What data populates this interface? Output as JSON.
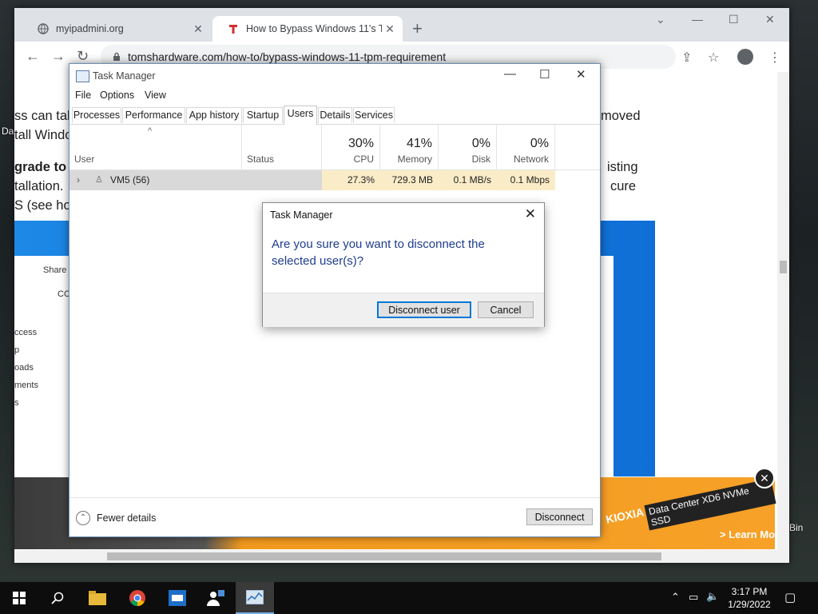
{
  "desktop": {
    "label_left": "Da",
    "label_right": "Bin"
  },
  "browser": {
    "tabs": [
      {
        "title": "myipadmini.org"
      },
      {
        "title": "How to Bypass Windows 11's TPM"
      }
    ],
    "new_tab": "+",
    "url": "tomshardware.com/how-to/bypass-windows-11-tpm-requirement",
    "article_lines": [
      "ss can tak",
      "tall Windo",
      "grade to",
      "tallation.",
      "S (see ho",
      "moved",
      "isting",
      "cure"
    ],
    "explorer": {
      "share": "Share",
      "path": "CO",
      "items": [
        "ccess",
        "p",
        "oads",
        "ments",
        "s"
      ]
    },
    "ad": {
      "learn_more": "> Learn Mo",
      "brand": "KIOXIA",
      "product": "Data Center  XD6  NVMe SSD"
    }
  },
  "taskmgr": {
    "title": "Task Manager",
    "menu": [
      "File",
      "Options",
      "View"
    ],
    "tabs": [
      "Processes",
      "Performance",
      "App history",
      "Startup",
      "Users",
      "Details",
      "Services"
    ],
    "selected_tab": "Users",
    "columns": {
      "user": "User",
      "status": "Status",
      "cpu": {
        "pct": "30%",
        "label": "CPU"
      },
      "memory": {
        "pct": "41%",
        "label": "Memory"
      },
      "disk": {
        "pct": "0%",
        "label": "Disk"
      },
      "network": {
        "pct": "0%",
        "label": "Network"
      }
    },
    "row": {
      "user": "VM5 (56)",
      "status": "",
      "cpu": "27.3%",
      "memory": "729.3 MB",
      "disk": "0.1 MB/s",
      "network": "0.1 Mbps"
    },
    "fewer_details": "Fewer details",
    "disconnect": "Disconnect"
  },
  "dialog": {
    "title": "Task Manager",
    "message": "Are you sure you want to disconnect the selected user(s)?",
    "confirm": "Disconnect user",
    "cancel": "Cancel"
  },
  "taskbar": {
    "time": "3:17 PM",
    "date": "1/29/2022"
  }
}
